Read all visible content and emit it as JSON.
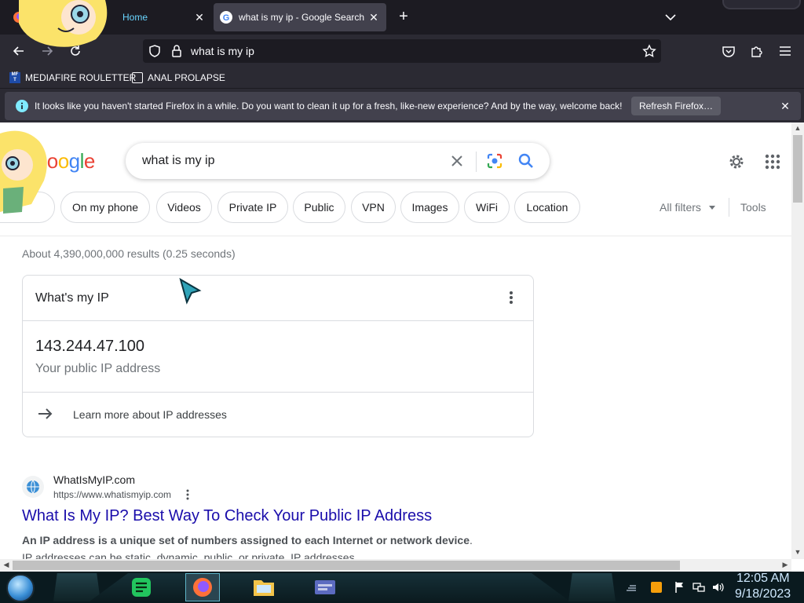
{
  "browser": {
    "tabs": [
      {
        "label": "Home",
        "active": false
      },
      {
        "label": "what is my ip - Google Search",
        "active": true
      }
    ],
    "address": "what is my ip",
    "bookmarks": [
      {
        "label": "MEDIAFIRE ROULETTER",
        "icon": "mediafire-icon"
      },
      {
        "label": "ANAL PROLAPSE",
        "icon": "bookmark-page-icon"
      }
    ],
    "notification": {
      "text": "It looks like you haven't started Firefox in a while. Do you want to clean it up for a fresh, like-new experience? And by the way, welcome back!",
      "button": "Refresh Firefox…"
    }
  },
  "google": {
    "logo_visible": "ogle",
    "query": "what is my ip",
    "chips": [
      "On my phone",
      "Videos",
      "Private IP",
      "Public",
      "VPN",
      "Images",
      "WiFi",
      "Location"
    ],
    "all_filters": "All filters",
    "tools": "Tools",
    "stats": "About 4,390,000,000 results (0.25 seconds)",
    "ip_card": {
      "title": "What's my IP",
      "ip": "143.244.47.100",
      "label": "Your public IP address",
      "learn_more": "Learn more about IP addresses"
    },
    "result1": {
      "site": "WhatIsMyIP.com",
      "url": "https://www.whatismyip.com",
      "title": "What Is My IP? Best Way To Check Your Public IP Address",
      "snippet_bold": "An IP address is a unique set of numbers assigned to each Internet or network device",
      "snippet_rest": ". IP addresses can be static, dynamic, public, or private. IP addresses ..."
    }
  },
  "taskbar": {
    "time": "12:05 AM",
    "date": "9/18/2023"
  },
  "colors": {
    "link": "#1a0dab",
    "firefox_dark": "#1c1b22",
    "firefox_toolbar": "#2b2a33"
  }
}
